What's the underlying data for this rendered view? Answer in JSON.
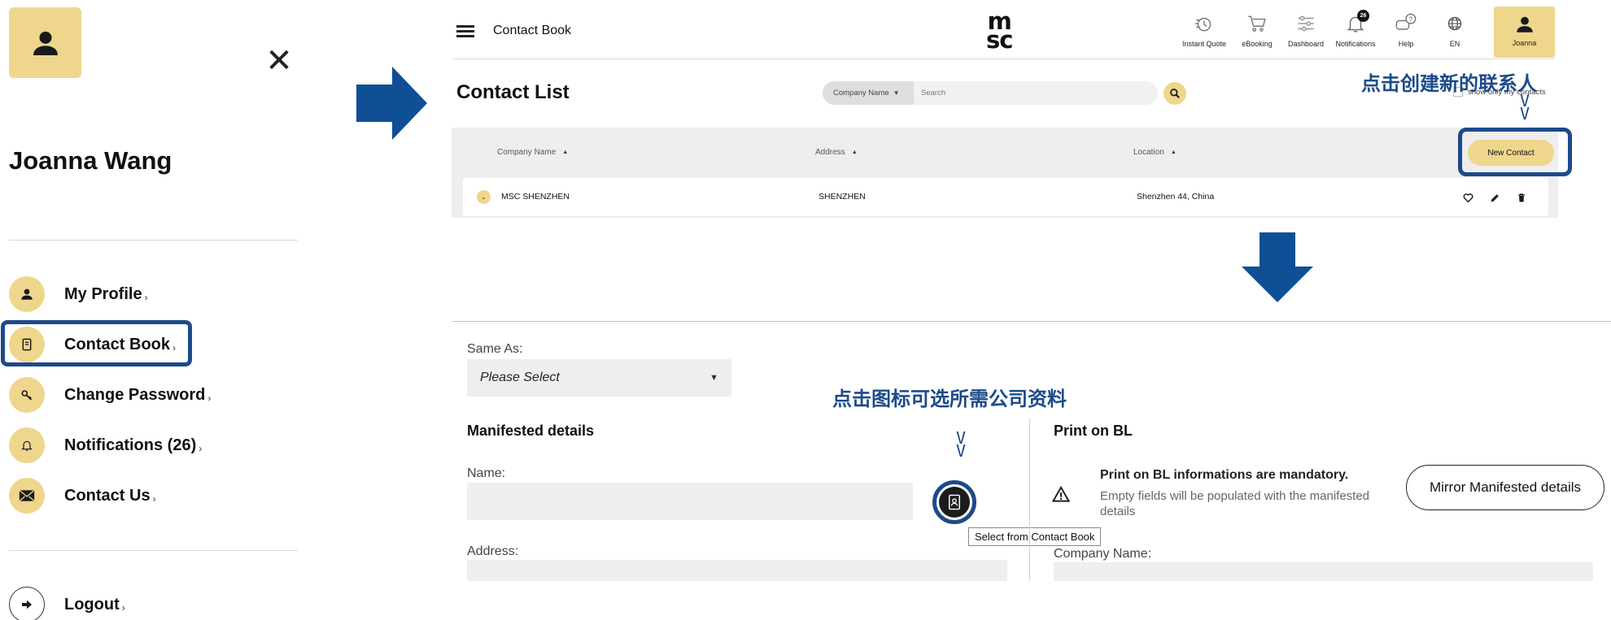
{
  "profile_panel": {
    "user_name": "Joanna Wang",
    "menu": [
      {
        "label": "My Profile",
        "icon": "person-icon"
      },
      {
        "label": "Contact Book",
        "icon": "book-icon"
      },
      {
        "label": "Change Password",
        "icon": "key-icon"
      },
      {
        "label": "Notifications (26)",
        "icon": "bell-icon"
      },
      {
        "label": "Contact Us",
        "icon": "envelope-icon"
      }
    ],
    "logout_label": "Logout",
    "chevron": "›"
  },
  "header": {
    "title": "Contact Book",
    "logo_line1": "m",
    "logo_line2": "sc",
    "nav": [
      {
        "label": "Instant Quote",
        "icon": "quote-icon"
      },
      {
        "label": "eBooking",
        "icon": "cart-icon"
      },
      {
        "label": "Dashboard",
        "icon": "sliders-icon"
      },
      {
        "label": "Notifications",
        "icon": "bell-icon",
        "badge": "26"
      },
      {
        "label": "Help",
        "icon": "help-chat-icon"
      },
      {
        "label": "EN",
        "icon": "globe-icon"
      }
    ],
    "user_tab_label": "Joanna"
  },
  "contact_list": {
    "title": "Contact List",
    "search": {
      "filter_label": "Company Name",
      "placeholder": "Search"
    },
    "only_mine_label": "show only my contacts",
    "columns": [
      "Company Name",
      "Address",
      "Location"
    ],
    "new_contact_label": "New Contact",
    "rows": [
      {
        "company": "MSC SHENZHEN",
        "address": "SHENZHEN",
        "location": "Shenzhen 44, China"
      }
    ]
  },
  "annotations": {
    "new_contact_hint": "点击创建新的联系人",
    "pick_company_hint": "点击图标可选所需公司资料",
    "chevron_marks": "V"
  },
  "form": {
    "same_as_label": "Same As:",
    "same_as_value": "Please Select",
    "manifested": {
      "title": "Manifested details",
      "name_label": "Name:",
      "address_label": "Address:",
      "tooltip": "Select from Contact Book"
    },
    "print_bl": {
      "title": "Print on BL",
      "mandatory": "Print on BL informations are mandatory.",
      "desc": "Empty fields will be populated with the manifested details",
      "mirror_button": "Mirror Manifested details",
      "company_label": "Company Name:"
    }
  },
  "colors": {
    "accent_yellow": "#eed68c",
    "highlight_blue": "#1d4a8a",
    "arrow_blue": "#0f4f96"
  }
}
